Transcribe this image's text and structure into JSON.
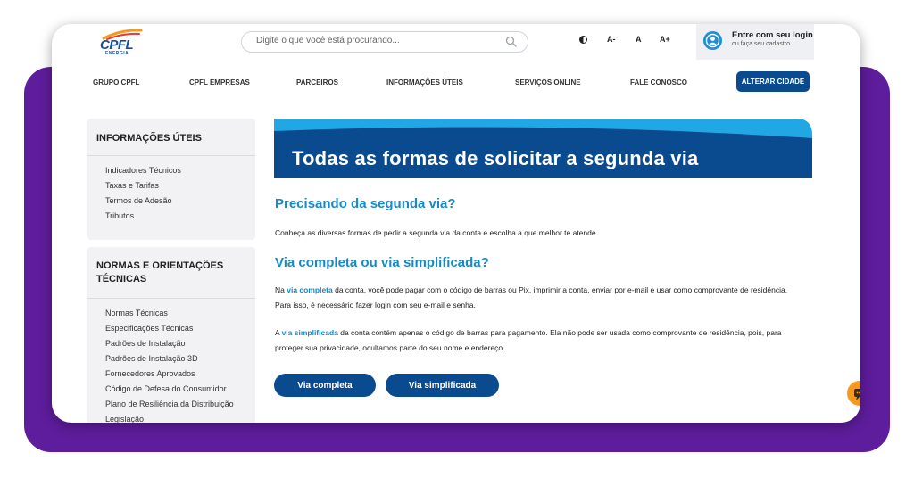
{
  "brand": {
    "name": "CPFL",
    "sub": "ENERGIA",
    "colors": {
      "primary": "#0a4a8e",
      "accent": "#1689c8",
      "frame": "#5e1d9c"
    }
  },
  "search": {
    "placeholder": "Digite o que você está procurando..."
  },
  "accessibility": {
    "contrast_icon": "contrast-icon",
    "font_decrease": "A-",
    "font_normal": "A",
    "font_increase": "A+"
  },
  "login": {
    "title": "Entre com seu login",
    "subtitle": "ou faça seu cadastro",
    "icon": "user-avatar-icon"
  },
  "nav": {
    "items": [
      "GRUPO CPFL",
      "CPFL EMPRESAS",
      "PARCEIROS",
      "INFORMAÇÕES ÚTEIS",
      "SERVIÇOS ONLINE",
      "FALE CONOSCO"
    ],
    "cta": "ALTERAR CIDADE"
  },
  "sidebar": {
    "sections": [
      {
        "title": "INFORMAÇÕES ÚTEIS",
        "links": [
          "Indicadores Técnicos",
          "Taxas e Tarifas",
          "Termos de Adesão",
          "Tributos"
        ]
      },
      {
        "title_line1": "NORMAS E ORIENTAÇÕES",
        "title_line2": "TÉCNICAS",
        "links": [
          "Normas Técnicas",
          "Especificações Técnicas",
          "Padrões de Instalação",
          "Padrões de Instalação 3D",
          "Fornecedores Aprovados",
          "Código de Defesa do Consumidor",
          "Plano de Resiliência da Distribuição",
          "Legislação"
        ]
      }
    ]
  },
  "main": {
    "banner_title": "Todas as formas de solicitar a segunda via",
    "h1": "Precisando da segunda via?",
    "p1": "Conheça as diversas formas de pedir a segunda via da conta e escolha a que melhor te atende.",
    "h2": "Via completa ou via simplificada?",
    "p2": {
      "pre": "Na ",
      "link": "via completa",
      "rest_line1": " da conta, você pode pagar com o código de barras ou Pix, imprimir a conta, enviar por e-mail e usar como comprovante de residência.",
      "line2": "Para isso, é necessário fazer login com seu e-mail e senha."
    },
    "p3": {
      "pre": "A ",
      "link": "via simplificada",
      "rest_line1": " da conta contém apenas o código de barras para pagamento. Ela não pode ser usada como comprovante de residência, pois, para",
      "line2": "proteger sua privacidade, ocultamos parte do seu nome e endereço."
    },
    "buttons": {
      "full": "Via completa",
      "simple": "Via simplificada"
    }
  },
  "chat": {
    "icon": "chat-icon"
  }
}
